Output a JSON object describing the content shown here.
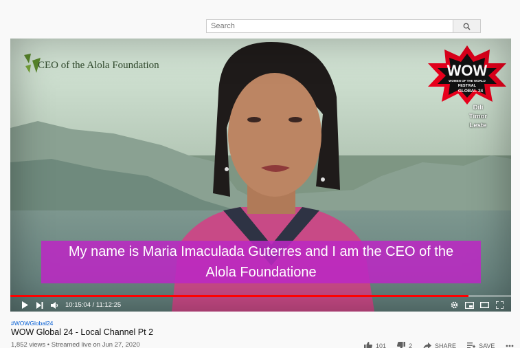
{
  "search": {
    "placeholder": "Search"
  },
  "video": {
    "logo_text": "CEO of the Alola Foundation",
    "badge": {
      "wow": "WOW",
      "line1": "WOMEN OF THE WORLD",
      "line2": "FESTIVAL",
      "line3": "GLOBAL 24"
    },
    "location": [
      "Dili",
      "Timor",
      "Leste"
    ],
    "caption_line1": "My name is Maria Imaculada Guterres and I am the CEO of the",
    "caption_line2": "Alola Foundatione",
    "time": "10:15:04 / 11:12:25",
    "progress": 0.915
  },
  "info": {
    "hashtag": "#WOWGlobal24",
    "title": "WOW Global 24 - Local Channel Pt 2",
    "meta": "1,852 views • Streamed live on Jun 27, 2020",
    "likes": "101",
    "dislikes": "2",
    "share_label": "SHARE",
    "save_label": "SAVE"
  },
  "colors": {
    "caption_bg": "#bb28c3",
    "progress": "#ff0000",
    "link": "#065fd4"
  },
  "icons": [
    "search-icon",
    "play-icon",
    "next-icon",
    "volume-icon",
    "settings-icon",
    "miniplayer-icon",
    "theater-icon",
    "fullscreen-icon",
    "thumbs-up-icon",
    "thumbs-down-icon",
    "share-icon",
    "save-icon",
    "more-icon"
  ]
}
